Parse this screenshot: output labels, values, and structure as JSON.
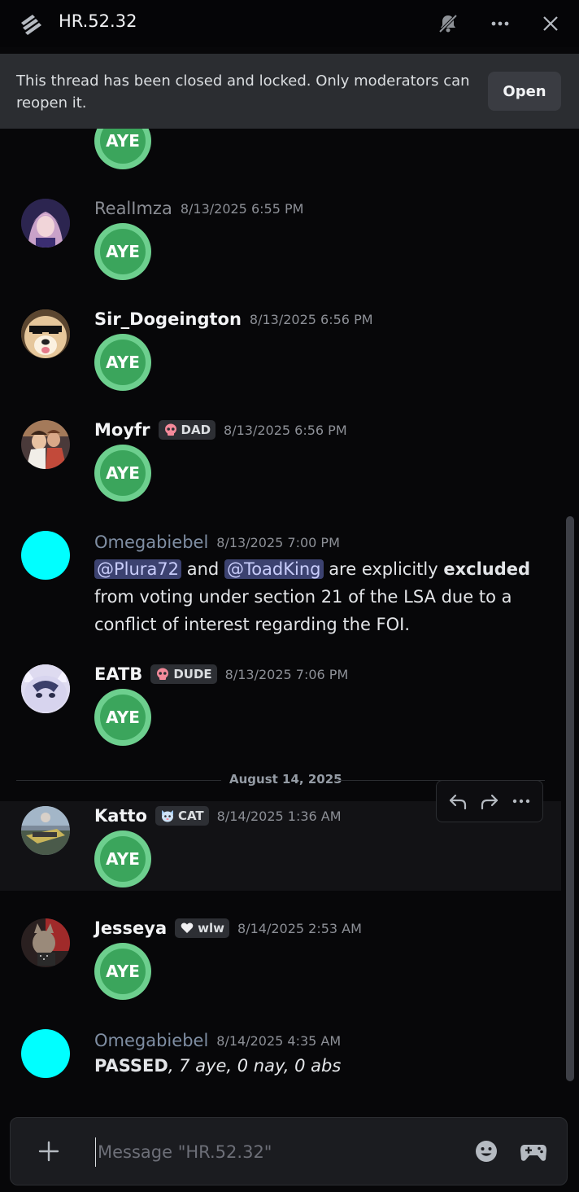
{
  "header": {
    "title": "HR.52.32",
    "icons": [
      "thread-icon",
      "bell-muted-icon",
      "more-icon",
      "close-icon"
    ]
  },
  "banner": {
    "text": "This thread has been closed and locked. Only moderators can reopen it.",
    "button": "Open"
  },
  "vote_label": "AYE",
  "messages": [
    {
      "author": "RealImza",
      "timestamp": "8/13/2025 6:55 PM"
    },
    {
      "author": "Sir_Dogeington",
      "timestamp": "8/13/2025 6:56 PM"
    },
    {
      "author": "Moyfr",
      "tag": "DAD",
      "timestamp": "8/13/2025 6:56 PM"
    },
    {
      "author": "Omegabiebel",
      "timestamp": "8/13/2025 7:00 PM",
      "mention1": "@Plura72",
      "and": "and",
      "mention2": "@ToadKing",
      "text1": "are explicitly",
      "bold": "excluded",
      "text2": "from voting under section 21 of the LSA due to a conflict of interest regarding the FOI."
    },
    {
      "author": "EATB",
      "tag": "DUDE",
      "timestamp": "8/13/2025 7:06 PM"
    },
    {
      "author": "Katto",
      "tag": "CAT",
      "timestamp": "8/14/2025 1:36 AM"
    },
    {
      "author": "Jesseya",
      "tag": "wlw",
      "timestamp": "8/14/2025 2:53 AM"
    },
    {
      "author": "Omegabiebel",
      "timestamp": "8/14/2025 4:35 AM",
      "bold": "PASSED",
      "rest": ", 7 aye, 0 nay, 0 abs"
    }
  ],
  "date_divider": "August 14, 2025",
  "composer": {
    "placeholder": "Message \"HR.52.32\""
  },
  "colors": {
    "background": "#070709",
    "aye_outer": "#6dcf8e",
    "aye_inner": "#3ba55c",
    "mention_bg": "#3c4270",
    "placeholder_avatar": "#00ffff"
  }
}
